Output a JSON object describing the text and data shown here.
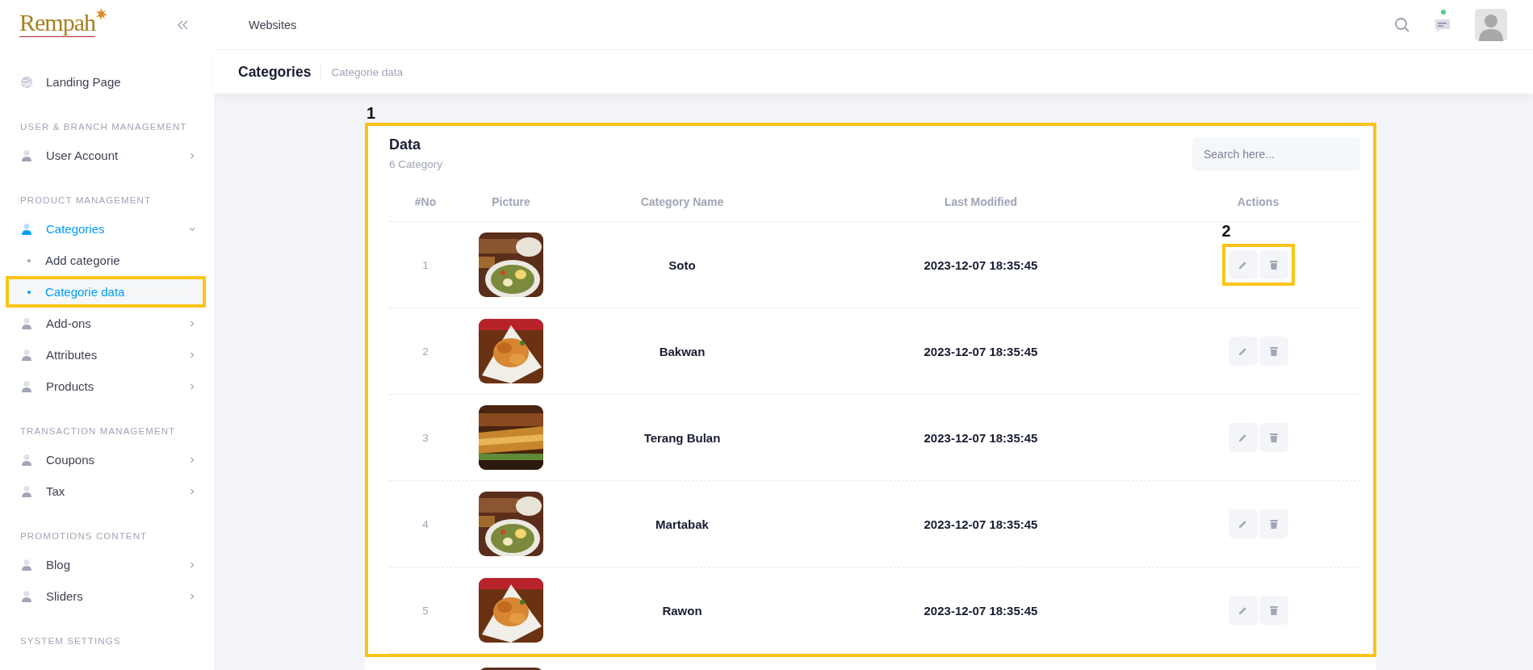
{
  "sidebar": {
    "logo": "Rempah",
    "groups": [
      {
        "items": [
          {
            "label": "Landing Page",
            "kind": "link",
            "selected": false,
            "highlighted": false
          }
        ]
      },
      {
        "heading": "USER & BRANCH MANAGEMENT",
        "items": [
          {
            "label": "User Account",
            "kind": "menu",
            "selected": false,
            "expanded": false,
            "highlighted": false
          }
        ]
      },
      {
        "heading": "PRODUCT MANAGEMENT",
        "items": [
          {
            "label": "Categories",
            "kind": "menu",
            "selected": true,
            "expanded": true,
            "highlighted": false
          },
          {
            "label": "Add categorie",
            "kind": "subitem",
            "selected": false,
            "highlighted": false
          },
          {
            "label": "Categorie data",
            "kind": "subitem",
            "selected": true,
            "highlighted": true
          },
          {
            "label": "Add-ons",
            "kind": "menu",
            "selected": false,
            "expanded": false,
            "highlighted": false
          },
          {
            "label": "Attributes",
            "kind": "menu",
            "selected": false,
            "expanded": false,
            "highlighted": false
          },
          {
            "label": "Products",
            "kind": "menu",
            "selected": false,
            "expanded": false,
            "highlighted": false
          }
        ]
      },
      {
        "heading": "TRANSACTION MANAGEMENT",
        "items": [
          {
            "label": "Coupons",
            "kind": "menu",
            "selected": false,
            "expanded": false,
            "highlighted": false
          },
          {
            "label": "Tax",
            "kind": "menu",
            "selected": false,
            "expanded": false,
            "highlighted": false
          }
        ]
      },
      {
        "heading": "PROMOTIONS CONTENT",
        "items": [
          {
            "label": "Blog",
            "kind": "menu",
            "selected": false,
            "expanded": false,
            "highlighted": false
          },
          {
            "label": "Sliders",
            "kind": "menu",
            "selected": false,
            "expanded": false,
            "highlighted": false
          }
        ]
      },
      {
        "heading": "SYSTEM SETTINGS"
      }
    ]
  },
  "topbar": {
    "title": "Websites",
    "notification_dot": true
  },
  "page_header": {
    "title": "Categories",
    "breadcrumb": "Categorie data"
  },
  "card": {
    "title": "Data",
    "subtitle": "6 Category",
    "callout": "1",
    "search": {
      "placeholder": "Search here..."
    },
    "columns": [
      "#No",
      "Picture",
      "Category Name",
      "Last Modified",
      "Actions"
    ],
    "rows": [
      {
        "no": "1",
        "name": "Soto",
        "modified": "2023-12-07 18:35:45",
        "actions_callout": "2"
      },
      {
        "no": "2",
        "name": "Bakwan",
        "modified": "2023-12-07 18:35:45"
      },
      {
        "no": "3",
        "name": "Terang Bulan",
        "modified": "2023-12-07 18:35:45"
      },
      {
        "no": "4",
        "name": "Martabak",
        "modified": "2023-12-07 18:35:45"
      },
      {
        "no": "5",
        "name": "Rawon",
        "modified": "2023-12-07 18:35:45"
      }
    ],
    "partial_row": {
      "picture": {
        "kind": "picture"
      }
    }
  }
}
